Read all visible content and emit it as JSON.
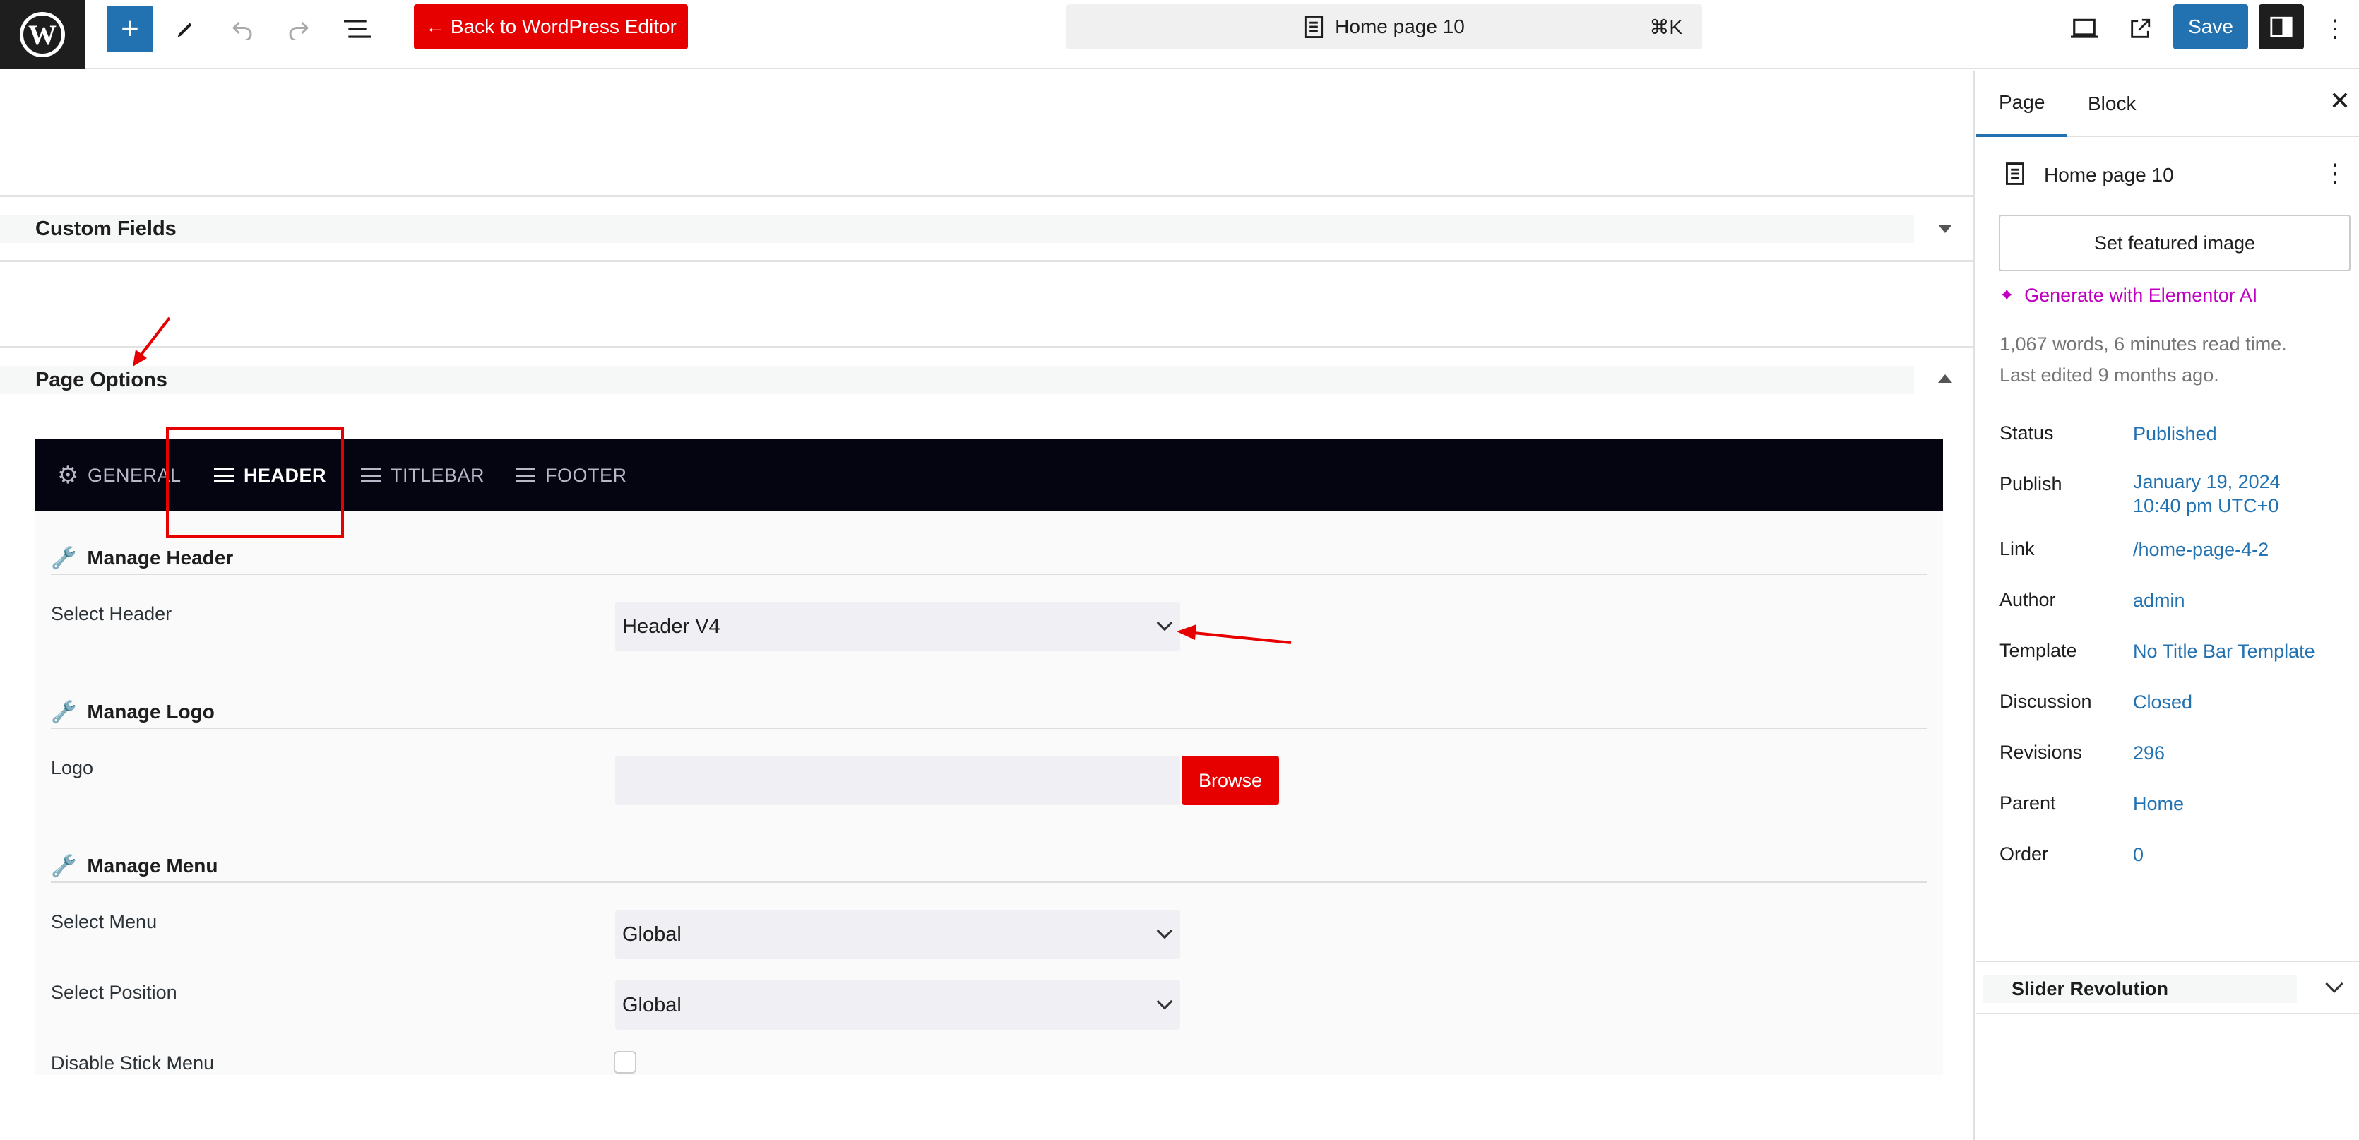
{
  "toolbar": {
    "back_label": "← Back to WordPress Editor",
    "document_title": "Home page 10",
    "shortcut": "⌘K",
    "save_label": "Save"
  },
  "metaboxes": {
    "custom_fields_title": "Custom Fields",
    "page_options_title": "Page Options"
  },
  "page_options": {
    "tabs": [
      {
        "label": "GENERAL",
        "icon": "gear-icon"
      },
      {
        "label": "HEADER",
        "icon": "menu-lines-icon",
        "active": true
      },
      {
        "label": "TITLEBAR",
        "icon": "menu-lines-icon"
      },
      {
        "label": "FOOTER",
        "icon": "menu-lines-icon"
      }
    ],
    "manage_header": {
      "title": "Manage Header",
      "select_header_label": "Select Header",
      "select_header_value": "Header V4"
    },
    "manage_logo": {
      "title": "Manage Logo",
      "logo_label": "Logo",
      "browse_label": "Browse"
    },
    "manage_menu": {
      "title": "Manage Menu",
      "select_menu_label": "Select Menu",
      "select_menu_value": "Global",
      "select_position_label": "Select Position",
      "select_position_value": "Global",
      "disable_stick_label": "Disable Stick Menu",
      "disable_stick_checked": false
    }
  },
  "sidebar": {
    "tabs": [
      "Page",
      "Block"
    ],
    "page_title": "Home page 10",
    "featured_image_label": "Set featured image",
    "generate_ai_label": "Generate with Elementor AI",
    "word_count": "1,067 words, 6 minutes read time.",
    "last_edited": "Last edited 9 months ago.",
    "rows": [
      {
        "label": "Status",
        "value": "Published"
      },
      {
        "label": "Publish",
        "value": "January 19, 2024",
        "value2": "10:40 pm UTC+0"
      },
      {
        "label": "Link",
        "value": "/home-page-4-2"
      },
      {
        "label": "Author",
        "value": "admin"
      },
      {
        "label": "Template",
        "value": "No Title Bar Template"
      },
      {
        "label": "Discussion",
        "value": "Closed"
      },
      {
        "label": "Revisions",
        "value": "296"
      },
      {
        "label": "Parent",
        "value": "Home"
      },
      {
        "label": "Order",
        "value": "0"
      }
    ],
    "slider_revolution_label": "Slider Revolution"
  },
  "colors": {
    "accent": "#2271b1",
    "red": "#e60000",
    "tab_bar": "#050512",
    "ai_magenta": "#c000c0"
  }
}
